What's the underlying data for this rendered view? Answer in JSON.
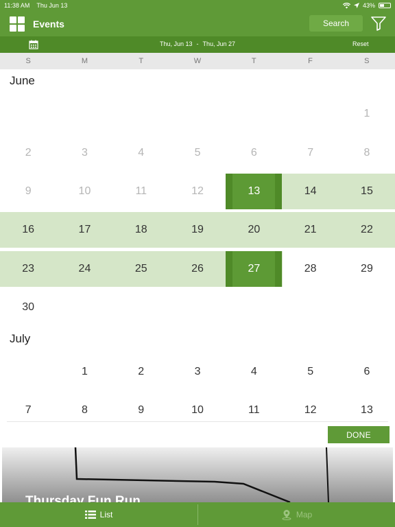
{
  "status": {
    "time": "11:38 AM",
    "date": "Thu Jun 13",
    "battery": "43%",
    "battery_level": 0.43
  },
  "header": {
    "title": "Events",
    "search_label": "Search"
  },
  "range": {
    "start": "Thu, Jun 13",
    "separator": "-",
    "end": "Thu, Jun 27",
    "reset_label": "Reset"
  },
  "weekdays": [
    "S",
    "M",
    "T",
    "W",
    "T",
    "F",
    "S"
  ],
  "months": [
    {
      "name": "June"
    },
    {
      "name": "July"
    }
  ],
  "done_label": "DONE",
  "event": {
    "title": "Thursday Fun Run"
  },
  "tabs": {
    "list_label": "List",
    "map_label": "Map"
  },
  "colors": {
    "brand": "#5f9a37",
    "brand_dark": "#4f8a28",
    "range_highlight": "#d5e6c8"
  }
}
